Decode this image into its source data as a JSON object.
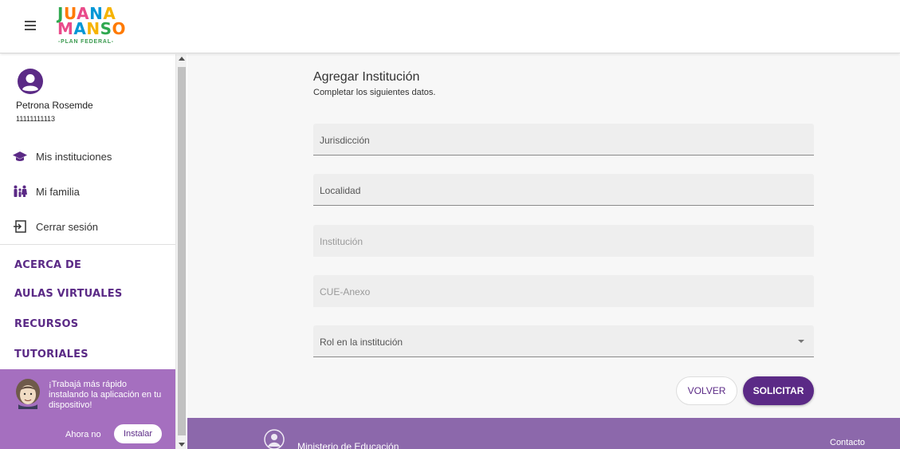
{
  "header": {
    "menu_icon": "hamburger-menu-icon",
    "logo": {
      "line1": "JUANA",
      "line2": "MANSO",
      "line3": "-PLAN FEDERAL-"
    }
  },
  "sidebar": {
    "user": {
      "name": "Petrona Rosemde",
      "id": "11111111113",
      "avatar_icon": "user-circle-icon"
    },
    "nav_items": [
      {
        "label": "Mis instituciones",
        "icon": "graduation-cap-icon"
      },
      {
        "label": "Mi familia",
        "icon": "family-icon"
      },
      {
        "label": "Cerrar sesión",
        "icon": "logout-icon"
      }
    ],
    "links": [
      "ACERCA DE",
      "AULAS VIRTUALES",
      "RECURSOS",
      "TUTORIALES"
    ],
    "install_banner": {
      "text": "¡Trabajá más rápido instalando la aplicación en tu dispositivo!",
      "dismiss_label": "Ahora no",
      "install_label": "Instalar"
    }
  },
  "form": {
    "title": "Agregar Institución",
    "subtitle": "Completar los siguientes datos.",
    "fields": [
      {
        "placeholder": "Jurisdicción",
        "state": "active"
      },
      {
        "placeholder": "Localidad",
        "state": "active"
      },
      {
        "placeholder": "Institución",
        "state": "disabled"
      },
      {
        "placeholder": "CUE-Anexo",
        "state": "disabled"
      },
      {
        "placeholder": "Rol en la institución",
        "state": "active",
        "type": "select"
      }
    ],
    "back_label": "VOLVER",
    "submit_label": "SOLICITAR"
  },
  "footer": {
    "ministry": "Ministerio de Educación",
    "contact": "Contacto"
  },
  "colors": {
    "brand_purple": "#5b2a86",
    "banner_purple": "#a56fbf",
    "footer_purple": "#8c68ab"
  }
}
